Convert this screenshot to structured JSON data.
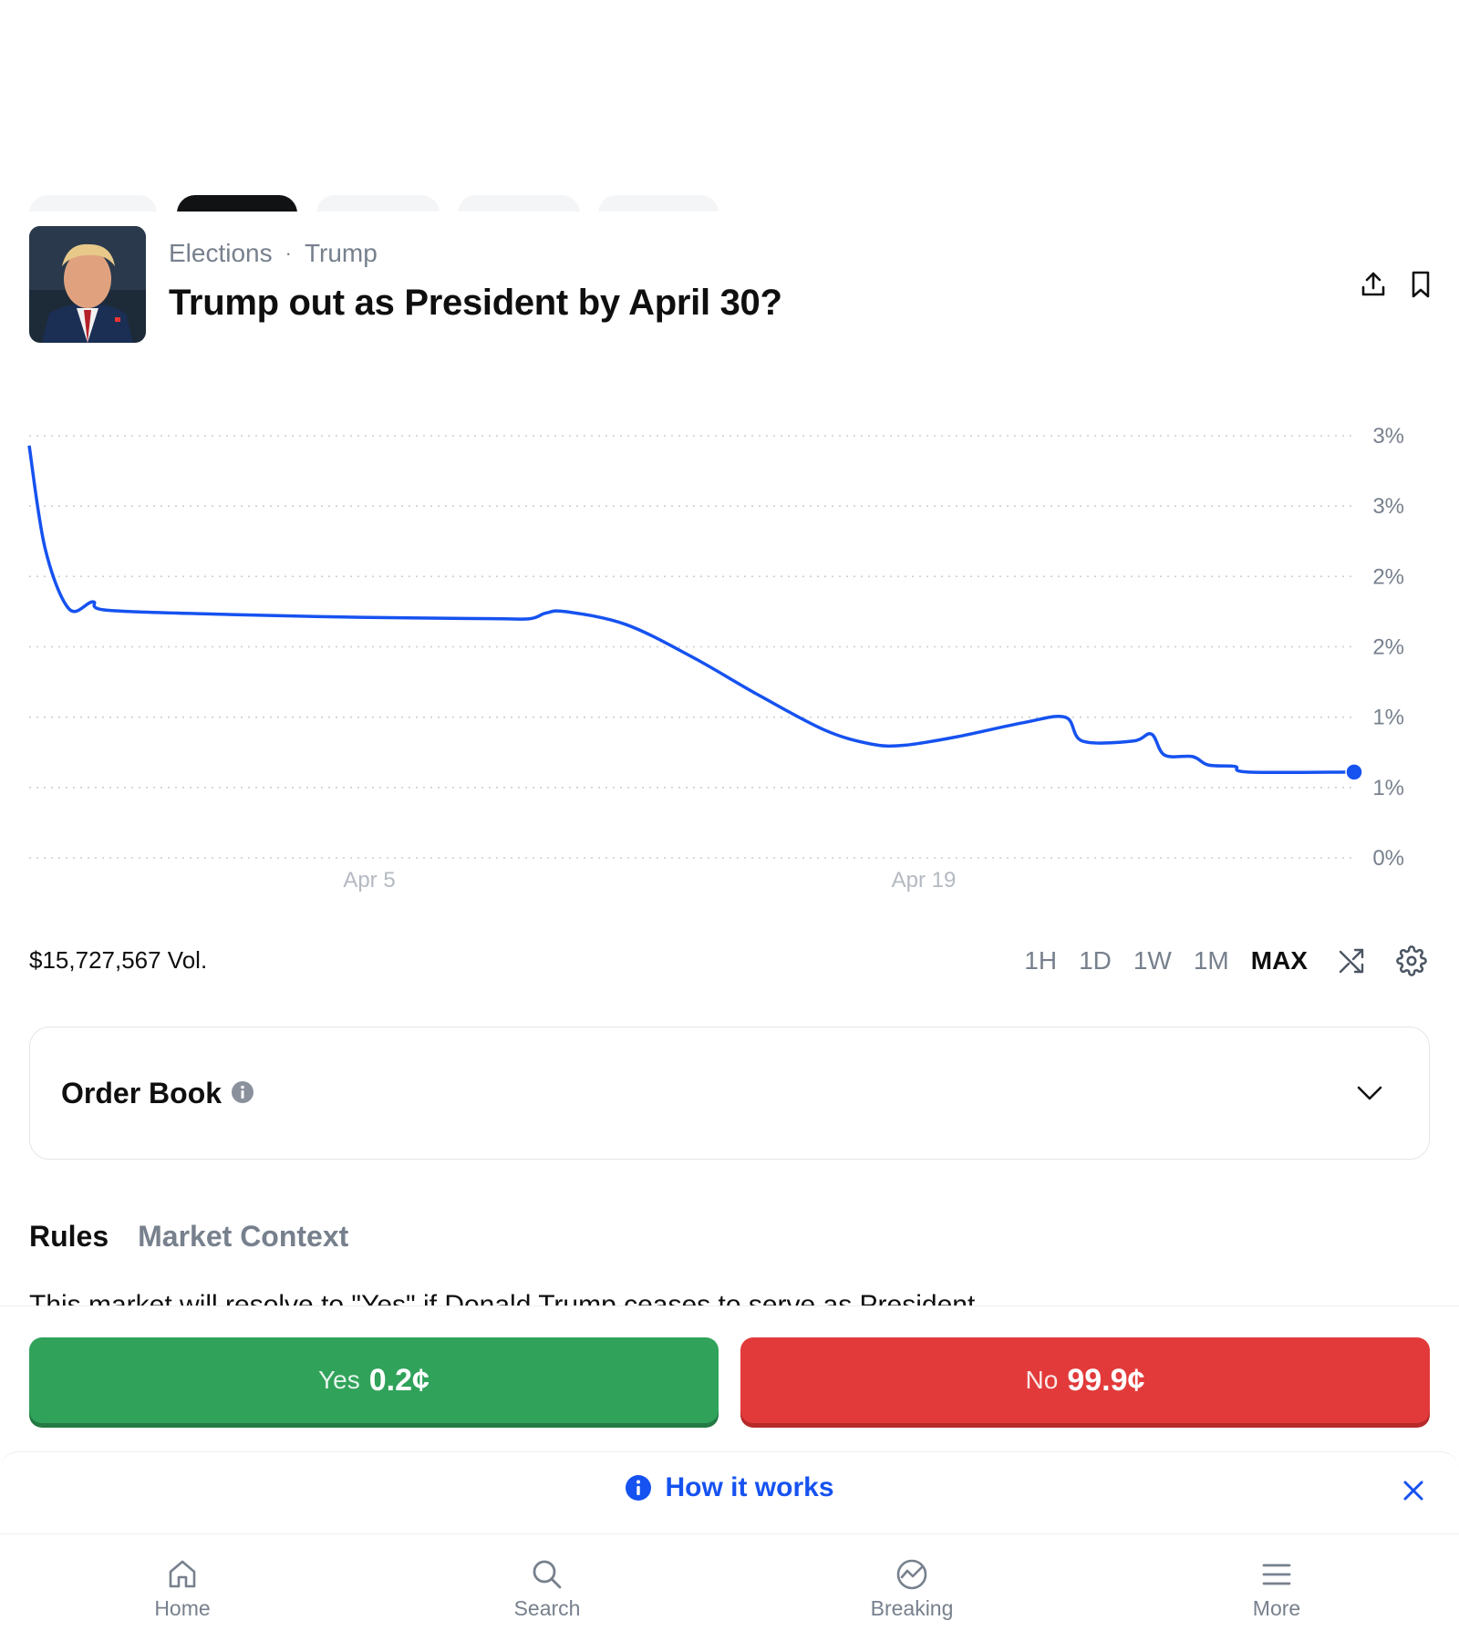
{
  "market": {
    "breadcrumb": [
      "Elections",
      "Trump"
    ],
    "breadcrumb_sep": "·",
    "title": "Trump out as President by April 30?"
  },
  "header_icons": [
    "share-icon",
    "bookmark-icon"
  ],
  "chart_data": {
    "type": "line",
    "title": "",
    "xlabel": "",
    "ylabel": "",
    "x_ticks": [
      "Apr 5",
      "Apr 19"
    ],
    "y_ticks": [
      "3%",
      "3%",
      "2%",
      "2%",
      "1%",
      "1%",
      "0%"
    ],
    "ylim": [
      0,
      3
    ],
    "grid": "dotted horizontal",
    "color": "#1652f0",
    "series": [
      {
        "points": [
          [
            0.0,
            2.93
          ],
          [
            0.012,
            2.2
          ],
          [
            0.03,
            1.77
          ],
          [
            0.048,
            1.82
          ],
          [
            0.059,
            1.76
          ],
          [
            0.15,
            1.73
          ],
          [
            0.25,
            1.71
          ],
          [
            0.35,
            1.7
          ],
          [
            0.378,
            1.7
          ],
          [
            0.39,
            1.74
          ],
          [
            0.405,
            1.75
          ],
          [
            0.45,
            1.66
          ],
          [
            0.5,
            1.43
          ],
          [
            0.55,
            1.16
          ],
          [
            0.6,
            0.91
          ],
          [
            0.635,
            0.81
          ],
          [
            0.66,
            0.8
          ],
          [
            0.7,
            0.86
          ],
          [
            0.75,
            0.96
          ],
          [
            0.782,
            1.0
          ],
          [
            0.795,
            0.83
          ],
          [
            0.833,
            0.83
          ],
          [
            0.847,
            0.88
          ],
          [
            0.857,
            0.73
          ],
          [
            0.878,
            0.72
          ],
          [
            0.89,
            0.66
          ],
          [
            0.91,
            0.65
          ],
          [
            0.92,
            0.61
          ],
          [
            1.0,
            0.61
          ]
        ]
      }
    ],
    "last_point_marker": true
  },
  "volume": "$15,727,567 Vol.",
  "ranges": [
    "1H",
    "1D",
    "1W",
    "1M",
    "MAX"
  ],
  "active_range": "MAX",
  "order_book": {
    "title": "Order Book"
  },
  "tabs": [
    {
      "label": "Rules",
      "active": true
    },
    {
      "label": "Market Context",
      "active": false
    }
  ],
  "rules_text": "This market will resolve to \"Yes\" if Donald Trump ceases to serve as President...",
  "trade": {
    "yes": {
      "label": "Yes",
      "price": "0.2¢",
      "color": "#30a25a"
    },
    "no": {
      "label": "No",
      "price": "99.9¢",
      "color": "#e23a3a"
    }
  },
  "banner": {
    "text": "How it works"
  },
  "nav": [
    {
      "label": "Home",
      "icon": "home-icon"
    },
    {
      "label": "Search",
      "icon": "search-icon"
    },
    {
      "label": "Breaking",
      "icon": "breaking-icon"
    },
    {
      "label": "More",
      "icon": "menu-icon"
    }
  ]
}
